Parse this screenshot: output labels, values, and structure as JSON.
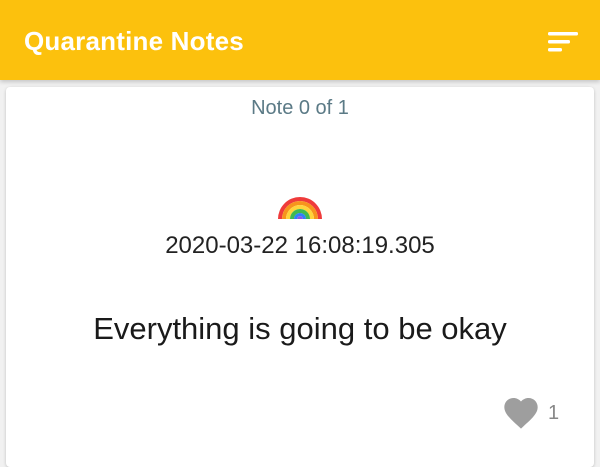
{
  "app_bar": {
    "title": "Quarantine Notes",
    "menu_icon": "sort-icon",
    "background_color": "#fcc10d"
  },
  "note": {
    "counter": "Note 0 of 1",
    "emoji": "rainbow",
    "timestamp": "2020-03-22 16:08:19.305",
    "text": "Everything is going to be okay",
    "like_icon": "heart-icon",
    "like_count": "1"
  }
}
